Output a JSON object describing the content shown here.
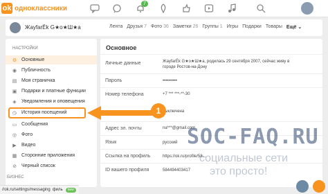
{
  "header": {
    "logo_letter": "ok",
    "logo_text": "одноклассники",
    "notification_count": "7",
    "icons": [
      "messages-icon",
      "discussions-icon",
      "notifications-icon",
      "guests-icon",
      "marks-icon",
      "video-icon",
      "music-icon",
      "avatar"
    ]
  },
  "profile": {
    "name": "ЖауfarЁk G★o★Ш★a",
    "nav": [
      {
        "label": "Лента",
        "count": ""
      },
      {
        "label": "Друзья",
        "count": "7"
      },
      {
        "label": "Фото",
        "count": "36"
      },
      {
        "label": "Заметки",
        "count": "26"
      },
      {
        "label": "Группы",
        "count": "1"
      },
      {
        "label": "Игры",
        "count": ""
      },
      {
        "label": "Подарки",
        "count": ""
      },
      {
        "label": "Товары",
        "count": ""
      }
    ],
    "more_label": "Ещё"
  },
  "sidebar": {
    "heading": "НАСТРОЙКИ",
    "items": [
      {
        "label": "Основные",
        "icon": "gear-icon",
        "active": true
      },
      {
        "label": "Публичность",
        "icon": "eye-icon"
      },
      {
        "label": "Моя страничка",
        "icon": "page-icon"
      },
      {
        "label": "Подарки и платные функции",
        "icon": "gift-icon"
      },
      {
        "label": "Уведомления и оповещения",
        "icon": "bell-icon"
      },
      {
        "label": "История посещений",
        "icon": "history-icon"
      },
      {
        "label": "Сообщения",
        "icon": "message-icon"
      },
      {
        "label": "Фото",
        "icon": "camera-icon"
      },
      {
        "label": "Видео",
        "icon": "video-icon"
      },
      {
        "label": "Сторонние приложения",
        "icon": "apps-icon"
      },
      {
        "label": "Черный список",
        "icon": "block-icon"
      }
    ],
    "business_heading": "БИЗНЕС"
  },
  "main": {
    "title": "Основное",
    "rows": [
      {
        "label": "Личные данные",
        "value": "ЖауfarЁk G★o★Ш★a, родилась 29 сентября 2007, сейчас живу в городе Ростов-на-Дону"
      },
      {
        "label": "Пароль",
        "value": "••••••••••"
      },
      {
        "label": "Номер телефона",
        "value": "+7 *** ***-**-30"
      },
      {
        "label": "",
        "value": "выключена"
      },
      {
        "label": "Адрес эл. почты",
        "value": "na***@gmail.com"
      },
      {
        "label": "Язык",
        "value": "русский"
      },
      {
        "label": "Ссылка на профиль",
        "value": "https://ok.ru/profile/58..."
      },
      {
        "label": "ID вашего профиля",
        "value": "584494403417"
      }
    ]
  },
  "annotation": {
    "number": "1",
    "color": "#f7931e"
  },
  "watermark": {
    "line1": "SOC-FAQ.RU",
    "line2": "социальные сети",
    "line3": "это просто!"
  },
  "status_bar": {
    "url": "//ok.ru/settings/messaging",
    "fragment": "филь",
    "badge": "new"
  },
  "colors": {
    "brand": "#f7931e",
    "active_bg": "#fdf0e1"
  }
}
